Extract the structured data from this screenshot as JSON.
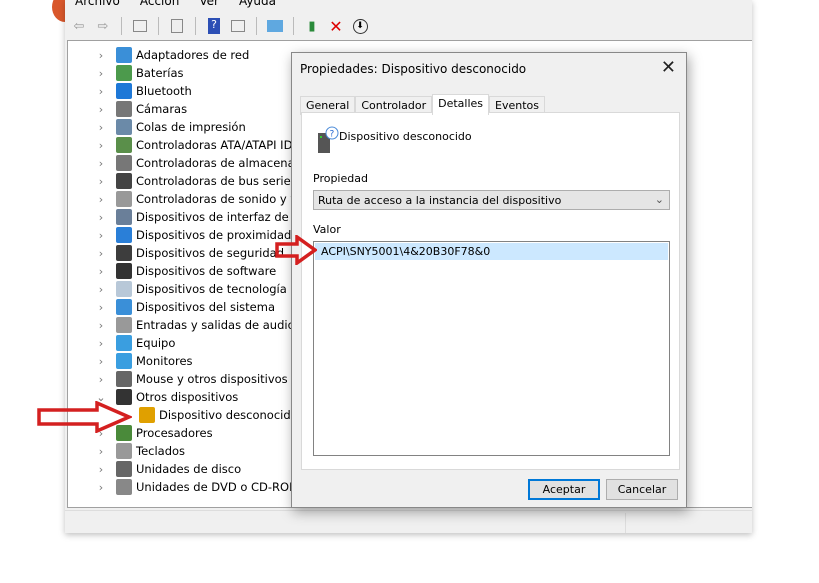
{
  "menu": [
    "Archivo",
    "Acción",
    "Ver",
    "Ayuda"
  ],
  "toolbar_icons": [
    "back-icon",
    "forward-icon",
    "show-hide-tree-icon",
    "properties-icon",
    "help-icon",
    "action-pane-icon",
    "scan-hardware-icon",
    "update-driver-icon",
    "uninstall-icon",
    "disable-icon"
  ],
  "tree": {
    "items": [
      {
        "label": "Adaptadores de red",
        "icon": "network-adapter-icon",
        "color": "#3a8fd8"
      },
      {
        "label": "Baterías",
        "icon": "battery-icon",
        "color": "#4c9a4c"
      },
      {
        "label": "Bluetooth",
        "icon": "bluetooth-icon",
        "color": "#1e78d7"
      },
      {
        "label": "Cámaras",
        "icon": "camera-icon",
        "color": "#777777"
      },
      {
        "label": "Colas de impresión",
        "icon": "printer-icon",
        "color": "#6b8aa8"
      },
      {
        "label": "Controladoras ATA/ATAPI IDE",
        "icon": "ide-controller-icon",
        "color": "#5a8f4a"
      },
      {
        "label": "Controladoras de almacenamie",
        "icon": "storage-controller-icon",
        "color": "#777777"
      },
      {
        "label": "Controladoras de bus serie univ",
        "icon": "usb-icon",
        "color": "#444444"
      },
      {
        "label": "Controladoras de sonido y víde",
        "icon": "speaker-icon",
        "color": "#999999"
      },
      {
        "label": "Dispositivos de interfaz de usua",
        "icon": "hid-icon",
        "color": "#6a7f99"
      },
      {
        "label": "Dispositivos de proximidad",
        "icon": "phone-icon",
        "color": "#2a7fd8"
      },
      {
        "label": "Dispositivos de seguridad",
        "icon": "security-key-icon",
        "color": "#3d3d3d"
      },
      {
        "label": "Dispositivos de software",
        "icon": "software-device-icon",
        "color": "#333333"
      },
      {
        "label": "Dispositivos de tecnología de m",
        "icon": "memory-tech-icon",
        "color": "#b8c8d8"
      },
      {
        "label": "Dispositivos del sistema",
        "icon": "system-device-icon",
        "color": "#3a8fd8"
      },
      {
        "label": "Entradas y salidas de audio",
        "icon": "audio-io-icon",
        "color": "#999999"
      },
      {
        "label": "Equipo",
        "icon": "computer-icon",
        "color": "#3a9ee0"
      },
      {
        "label": "Monitores",
        "icon": "monitor-icon",
        "color": "#3a9ee0"
      },
      {
        "label": "Mouse y otros dispositivos señ",
        "icon": "mouse-icon",
        "color": "#666666"
      },
      {
        "label": "Otros dispositivos",
        "icon": "other-devices-icon",
        "color": "#333333",
        "expanded": true
      },
      {
        "label": "Dispositivo desconocido",
        "icon": "unknown-device-warning-icon",
        "color": "#e0a000",
        "child": true
      },
      {
        "label": "Procesadores",
        "icon": "processor-icon",
        "color": "#4a8a3a"
      },
      {
        "label": "Teclados",
        "icon": "keyboard-icon",
        "color": "#999999"
      },
      {
        "label": "Unidades de disco",
        "icon": "disk-drive-icon",
        "color": "#666666"
      },
      {
        "label": "Unidades de DVD o CD-ROM",
        "icon": "dvd-drive-icon",
        "color": "#888888"
      }
    ]
  },
  "dialog": {
    "title": "Propiedades: Dispositivo desconocido",
    "tabs": [
      "General",
      "Controlador",
      "Detalles",
      "Eventos"
    ],
    "active_tab": "Detalles",
    "device_name": "Dispositivo desconocido",
    "property_label": "Propiedad",
    "property_value": "Ruta de acceso a la instancia del dispositivo",
    "value_label": "Valor",
    "value": "ACPI\\SNY5001\\4&20B30F78&0",
    "ok": "Aceptar",
    "cancel": "Cancelar"
  },
  "colors": {
    "annotation_arrow": "#d42020",
    "selection": "#cce8ff",
    "default_button_border": "#0078d7"
  }
}
